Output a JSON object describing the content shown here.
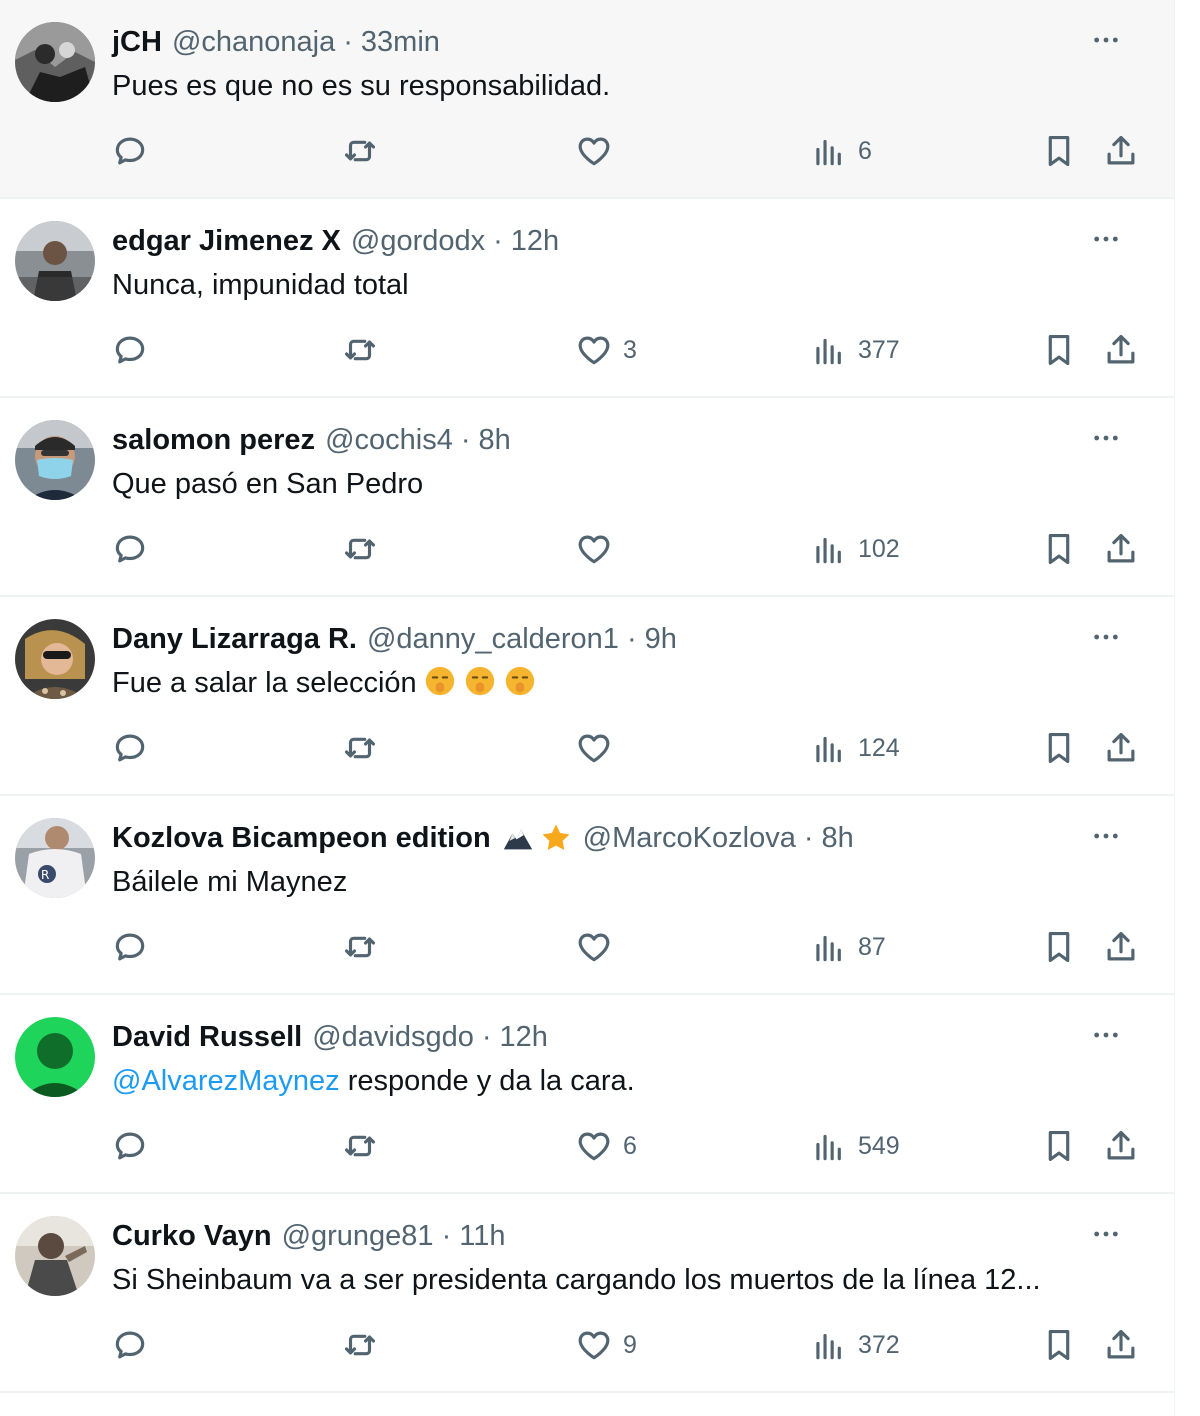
{
  "colors": {
    "text_primary": "#0f1419",
    "text_secondary": "#536471",
    "mention": "#1d9bf0",
    "divider": "#eff3f4",
    "hover_bg": "#f7f7f7"
  },
  "tweets": [
    {
      "name": "jCH",
      "handle": "@chanonaja",
      "separator": "·",
      "time": "33min",
      "text": "Pues es que no es su responsabilidad.",
      "replies": "",
      "likes": "",
      "views": "6"
    },
    {
      "name": "edgar Jimenez X",
      "handle": "@gordodx",
      "separator": "·",
      "time": "12h",
      "text": "Nunca, impunidad total",
      "replies": "",
      "likes": "3",
      "views": "377"
    },
    {
      "name": "salomon perez",
      "handle": "@cochis4",
      "separator": "·",
      "time": "8h",
      "text": "Que pasó en San Pedro",
      "replies": "",
      "likes": "",
      "views": "102"
    },
    {
      "name": "Dany Lizarraga R.",
      "handle": "@danny_calderon1",
      "separator": "·",
      "time": "9h",
      "text": "Fue a salar la selección",
      "emoji_icon": "shushing-face-icon",
      "replies": "",
      "likes": "",
      "views": "124"
    },
    {
      "name": "Kozlova Bicampeon edition",
      "badge_icons": [
        "eagle-icon",
        "star-icon"
      ],
      "handle": "@MarcoKozlova",
      "separator": "·",
      "time": "8h",
      "text": "Báilele mi Maynez",
      "replies": "",
      "likes": "",
      "views": "87"
    },
    {
      "name": "David Russell",
      "handle": "@davidsgdo",
      "separator": "·",
      "time": "12h",
      "mention": "@AlvarezMaynez",
      "text": " responde y da la cara.",
      "replies": "",
      "likes": "6",
      "views": "549"
    },
    {
      "name": "Curko Vayn",
      "handle": "@grunge81",
      "separator": "·",
      "time": "11h",
      "text": "Si Sheinbaum va a ser presidenta cargando los muertos de la línea 12...",
      "replies": "",
      "likes": "9",
      "views": "372"
    }
  ]
}
